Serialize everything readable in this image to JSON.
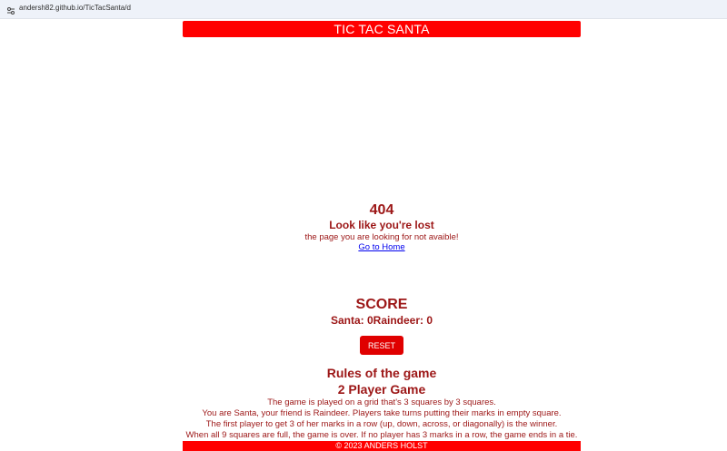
{
  "browser": {
    "url": "andersh82.github.io/TicTacSanta/d",
    "site_icon": "site-settings-icon"
  },
  "header": {
    "title": "TIC TAC SANTA"
  },
  "not_found": {
    "code": "404",
    "title": "Look like you're lost",
    "message": "the page you are looking for not avaible!",
    "link_label": "Go to Home"
  },
  "score": {
    "title": "SCORE",
    "line": "Santa: 0Raindeer: 0",
    "reset_label": "RESET"
  },
  "rules": {
    "title": "Rules of the game",
    "subtitle": "2 Player Game",
    "lines": [
      "The game is played on a grid that's 3 squares by 3 squares.",
      "You are Santa, your friend is Raindeer. Players take turns putting their marks in empty square.",
      "The first player to get 3 of her marks in a row (up, down, across, or diagonally) is the winner.",
      "When all 9 squares are full, the game is over. If no player has 3 marks in a row, the game ends in a tie."
    ]
  },
  "footer": {
    "text": "© 2023 ANDERS HOLST"
  },
  "colors": {
    "brand_red": "#ff0000",
    "text_dark_red": "#9c1616",
    "button_red": "#e00000",
    "link_blue": "#0000ee"
  }
}
